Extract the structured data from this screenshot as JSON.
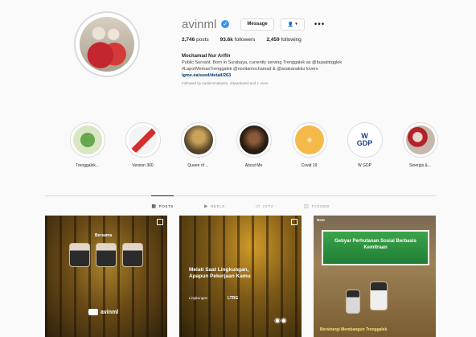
{
  "profile": {
    "username": "avinml",
    "message_label": "Message",
    "follow_label": "▾",
    "more_label": "•••",
    "stats": {
      "posts": "2,746",
      "posts_label": "posts",
      "followers": "93.6k",
      "followers_label": "followers",
      "following": "2,459",
      "following_label": "following"
    },
    "fullname": "Mochamad Nur Arifin",
    "bio_line1": "Public Servant. Born in Surabaya, currently serving Trenggalek as @bupatitrgglek",
    "bio_line2": "#LaporMemasTrenggalek @novitamochamad & @anakanakku lovers",
    "link": "igme.ea/seed/detail/263",
    "followed_by": "Followed by nadiemmakarim, ridwankamil and 1 more"
  },
  "highlights": [
    {
      "label": "Trenggalek...",
      "bg": "#d9e7c4"
    },
    {
      "label": "Version 360",
      "bg": "#f4f4f4"
    },
    {
      "label": "Queen of ...",
      "bg": "#5b4a2c"
    },
    {
      "label": "About Me",
      "bg": "#2c1e13"
    },
    {
      "label": "Covid 19",
      "bg": "#f5b94a"
    },
    {
      "label": "W GDP",
      "bg": "#ffffff"
    },
    {
      "label": "Sinergis &...",
      "bg": "#c8b7ac"
    }
  ],
  "tabs": [
    {
      "label": "POSTS",
      "icon": "grid-icon",
      "active": true
    },
    {
      "label": "REELS",
      "icon": "reels-icon",
      "active": false
    },
    {
      "label": "IGTV",
      "icon": "igtv-icon",
      "active": false
    },
    {
      "label": "TAGGED",
      "icon": "tag-icon",
      "active": false
    }
  ],
  "posts": [
    {
      "title": "Bersama",
      "channel": "avinml"
    },
    {
      "title": "Melati Saat Lingkungan, Apapun Pekerjaan Kamu",
      "tag": "Lingkungan",
      "brand": "LTRG"
    },
    {
      "title": "Gebyar Perhutanan Sosial Berbasis Kemitraan",
      "caption": "Bersinergi Membangun Trenggalek",
      "badge": "Next"
    }
  ],
  "colors": {
    "accent": "#3897f0",
    "text": "#262626",
    "muted": "#8e8e8e",
    "border": "#dbdbdb"
  }
}
